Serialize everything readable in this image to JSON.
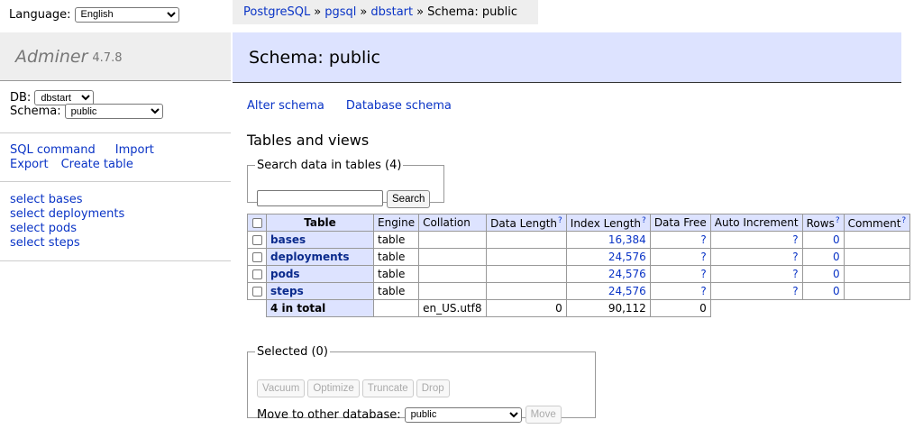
{
  "language": {
    "label": "Language:",
    "selected": "English"
  },
  "breadcrumb": {
    "items": [
      "PostgreSQL",
      "pgsql",
      "dbstart"
    ],
    "separator": "»",
    "current": "Schema: public"
  },
  "logo": {
    "name": "Adminer",
    "version": "4.7.8"
  },
  "db": {
    "label": "DB:",
    "selected": "dbstart"
  },
  "schema": {
    "label": "Schema:",
    "selected": "public"
  },
  "commands": {
    "sql_command": "SQL command",
    "import": "Import",
    "export": "Export",
    "create_table": "Create table"
  },
  "table_links": [
    "select bases",
    "select deployments",
    "select pods",
    "select steps"
  ],
  "page": {
    "title": "Schema: public",
    "actions": [
      "Alter schema",
      "Database schema"
    ],
    "section_title": "Tables and views"
  },
  "search": {
    "legend": "Search data in tables (4)",
    "value": "",
    "button": "Search"
  },
  "help_mark": "?",
  "table": {
    "headers": {
      "table": "Table",
      "engine": "Engine",
      "collation": "Collation",
      "data_length": "Data Length",
      "index_length": "Index Length",
      "data_free": "Data Free",
      "auto_increment": "Auto Increment",
      "rows": "Rows",
      "comment": "Comment"
    },
    "rows": [
      {
        "name": "bases",
        "engine": "table",
        "collation": "",
        "data_length": "",
        "index_length": "16,384",
        "data_free": "?",
        "auto_increment": "?",
        "rows": "0",
        "comment": ""
      },
      {
        "name": "deployments",
        "engine": "table",
        "collation": "",
        "data_length": "",
        "index_length": "24,576",
        "data_free": "?",
        "auto_increment": "?",
        "rows": "0",
        "comment": ""
      },
      {
        "name": "pods",
        "engine": "table",
        "collation": "",
        "data_length": "",
        "index_length": "24,576",
        "data_free": "?",
        "auto_increment": "?",
        "rows": "0",
        "comment": ""
      },
      {
        "name": "steps",
        "engine": "table",
        "collation": "",
        "data_length": "",
        "index_length": "24,576",
        "data_free": "?",
        "auto_increment": "?",
        "rows": "0",
        "comment": ""
      }
    ],
    "total": {
      "label": "4 in total",
      "collation": "en_US.utf8",
      "data_length": "0",
      "index_length": "90,112",
      "data_free": "0"
    }
  },
  "selected": {
    "legend": "Selected (0)",
    "buttons": [
      "Vacuum",
      "Optimize",
      "Truncate",
      "Drop"
    ],
    "move_label": "Move to other database:",
    "move_target": "public",
    "move_button": "Move"
  },
  "colors": {
    "link": "#0a34c6",
    "header_bg": "#dde3ff",
    "sidebar_bg": "#eeeeee"
  }
}
